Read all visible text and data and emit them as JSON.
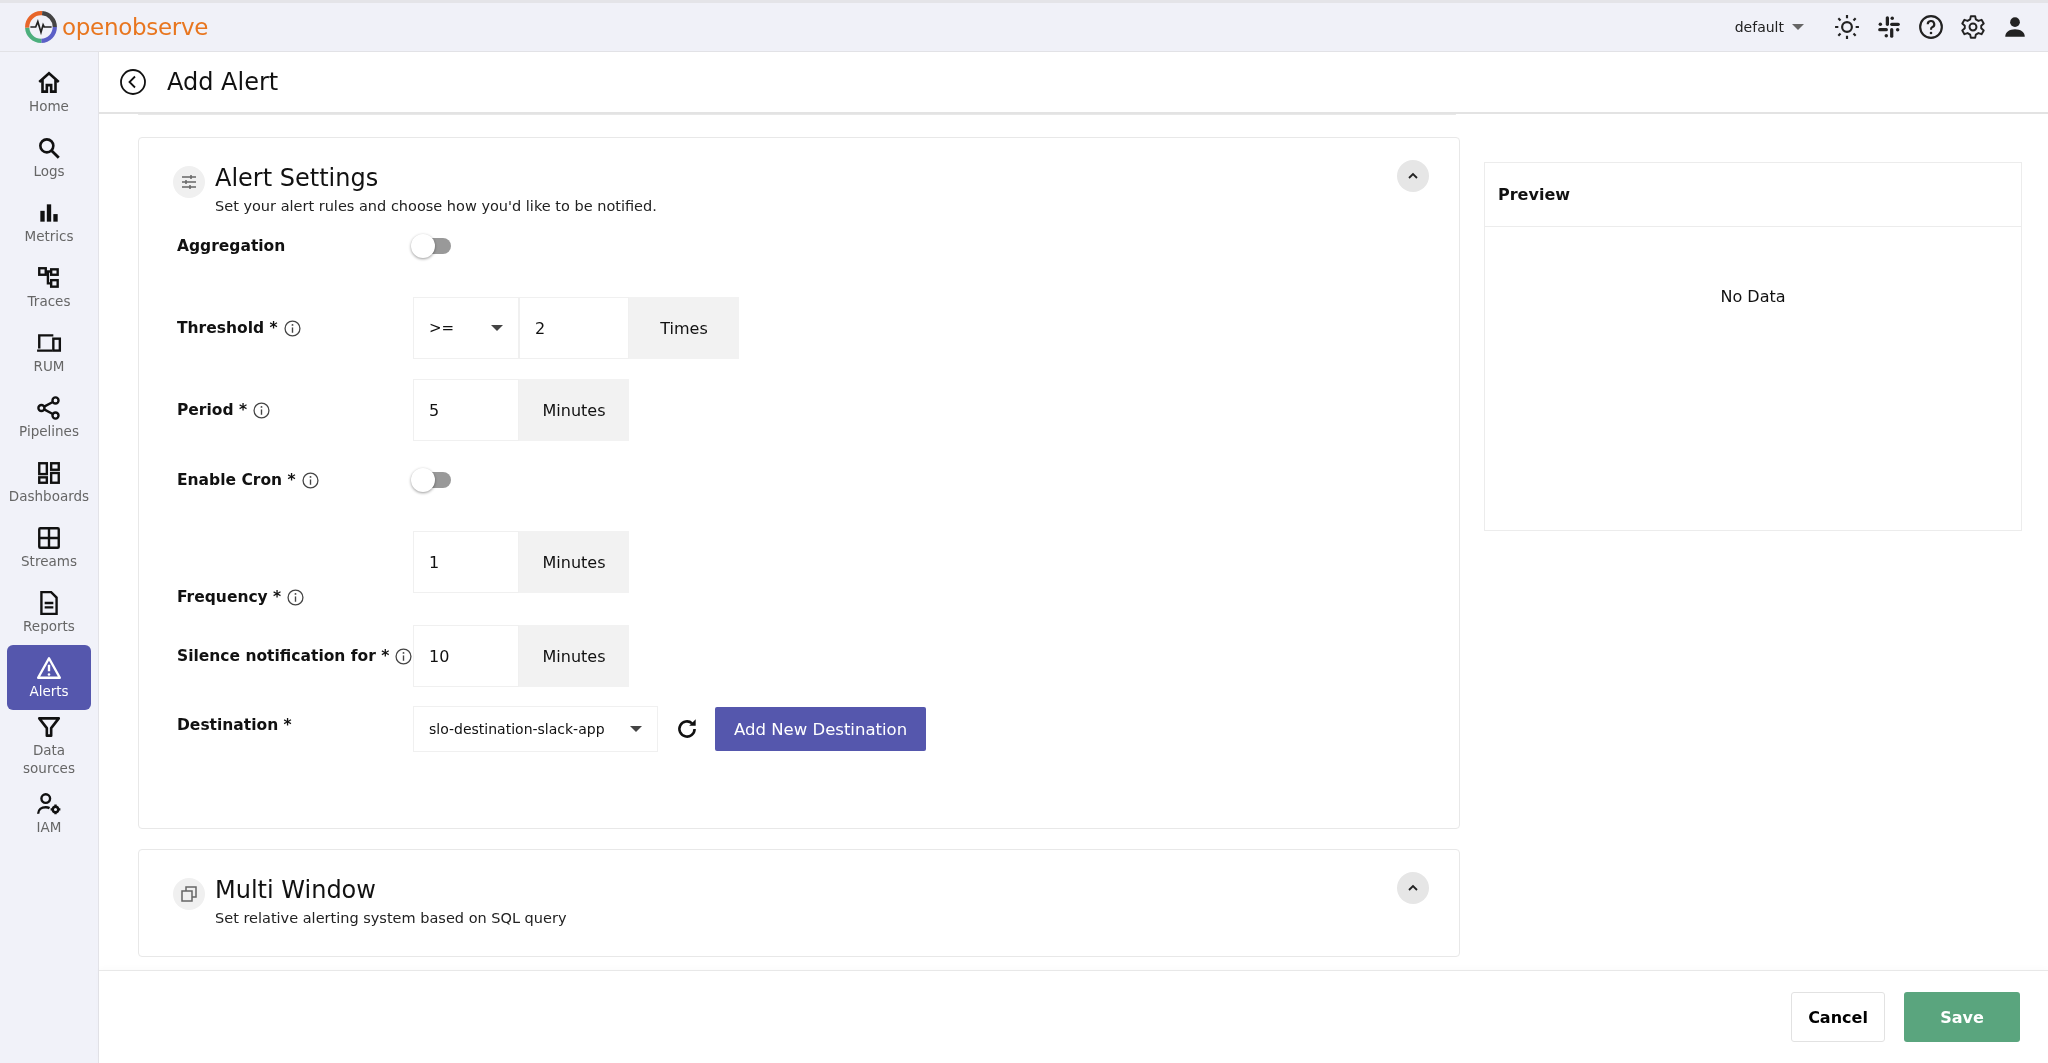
{
  "header": {
    "logo_text": "openobserve",
    "org": "default"
  },
  "sidebar": {
    "items": [
      {
        "label": "Home",
        "kind": "home",
        "selected": false
      },
      {
        "label": "Logs",
        "kind": "search",
        "selected": false
      },
      {
        "label": "Metrics",
        "kind": "bars",
        "selected": false
      },
      {
        "label": "Traces",
        "kind": "traces",
        "selected": false
      },
      {
        "label": "RUM",
        "kind": "devices",
        "selected": false
      },
      {
        "label": "Pipelines",
        "kind": "share",
        "selected": false
      },
      {
        "label": "Dashboards",
        "kind": "dashboard",
        "selected": false
      },
      {
        "label": "Streams",
        "kind": "grid",
        "selected": false
      },
      {
        "label": "Reports",
        "kind": "doc",
        "selected": false
      },
      {
        "label": "Alerts",
        "kind": "warning",
        "selected": true
      },
      {
        "label": "Data sources",
        "kind": "filter",
        "selected": false
      },
      {
        "label": "IAM",
        "kind": "usergear",
        "selected": false
      }
    ]
  },
  "page": {
    "title": "Add Alert"
  },
  "alert_settings": {
    "title": "Alert Settings",
    "subtitle": "Set your alert rules and choose how you'd like to be notified.",
    "expanded": true,
    "fields": [
      {
        "kind": "toggle",
        "label": "Aggregation",
        "info": false,
        "on": false
      },
      {
        "kind": "threshold",
        "label": "Threshold *",
        "info": true,
        "operator": ">=",
        "value": "2",
        "unit": "Times"
      },
      {
        "kind": "number",
        "label": "Period *",
        "info": true,
        "value": "5",
        "unit": "Minutes"
      },
      {
        "kind": "toggle",
        "label": "Enable Cron *",
        "info": true,
        "on": false
      },
      {
        "kind": "number",
        "label": "Frequency *",
        "info": true,
        "value": "1",
        "unit": "Minutes"
      },
      {
        "kind": "number",
        "label": "Silence notification for *",
        "info": true,
        "value": "10",
        "unit": "Minutes"
      },
      {
        "kind": "select",
        "label": "Destination *",
        "info": false,
        "value": "slo-destination-slack-app",
        "action": "Add New Destination"
      }
    ]
  },
  "multi_window": {
    "title": "Multi Window",
    "subtitle": "Set relative alerting system based on SQL query",
    "expanded": true
  },
  "preview": {
    "title": "Preview",
    "empty_text": "No Data"
  },
  "footer": {
    "cancel": "Cancel",
    "save": "Save"
  }
}
